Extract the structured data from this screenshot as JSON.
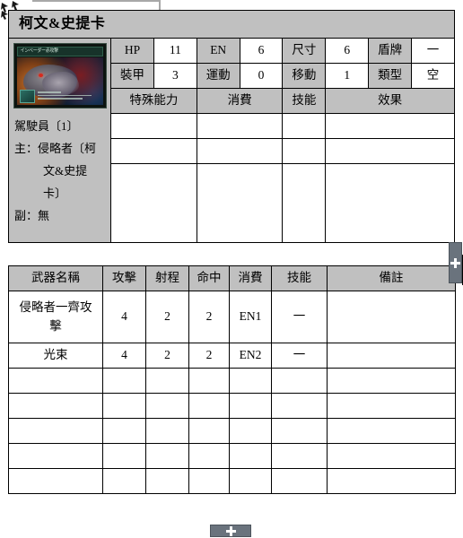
{
  "title": "柯文&史提卡",
  "portrait": {
    "art_banner_text": "インベーダー赤攻撃",
    "alt": "侵略者卡片插圖"
  },
  "pilot": {
    "heading": "駕駛員〔1〕",
    "main_line1": "主：侵略者〔柯",
    "main_line2": "文&史提",
    "main_line3": "卡〕",
    "sub": "副：無"
  },
  "stats": {
    "row1": [
      {
        "label": "HP",
        "value": "11"
      },
      {
        "label": "EN",
        "value": "6"
      },
      {
        "label": "尺寸",
        "value": "6"
      },
      {
        "label": "盾牌",
        "value": "一"
      }
    ],
    "row2": [
      {
        "label": "裝甲",
        "value": "3"
      },
      {
        "label": "運動",
        "value": "0"
      },
      {
        "label": "移動",
        "value": "1"
      },
      {
        "label": "類型",
        "value": "空"
      }
    ]
  },
  "ability_table": {
    "headers": [
      "特殊能力",
      "消費",
      "技能",
      "效果"
    ],
    "rows": [
      [
        "",
        "",
        "",
        ""
      ],
      [
        "",
        "",
        "",
        ""
      ],
      [
        "",
        "",
        "",
        ""
      ]
    ]
  },
  "weapon_table": {
    "headers": [
      "武器名稱",
      "攻擊",
      "射程",
      "命中",
      "消費",
      "技能",
      "備註"
    ],
    "rows": [
      {
        "name_line1": "侵略者一齊攻",
        "name_line2": "擊",
        "attack": "4",
        "range": "2",
        "hit": "2",
        "cost": "EN1",
        "skill": "一",
        "note": ""
      },
      {
        "name_line1": "光束",
        "name_line2": "",
        "attack": "4",
        "range": "2",
        "hit": "2",
        "cost": "EN2",
        "skill": "一",
        "note": ""
      },
      {
        "name_line1": "",
        "name_line2": "",
        "attack": "",
        "range": "",
        "hit": "",
        "cost": "",
        "skill": "",
        "note": ""
      },
      {
        "name_line1": "",
        "name_line2": "",
        "attack": "",
        "range": "",
        "hit": "",
        "cost": "",
        "skill": "",
        "note": ""
      },
      {
        "name_line1": "",
        "name_line2": "",
        "attack": "",
        "range": "",
        "hit": "",
        "cost": "",
        "skill": "",
        "note": ""
      },
      {
        "name_line1": "",
        "name_line2": "",
        "attack": "",
        "range": "",
        "hit": "",
        "cost": "",
        "skill": "",
        "note": ""
      },
      {
        "name_line1": "",
        "name_line2": "",
        "attack": "",
        "range": "",
        "hit": "",
        "cost": "",
        "skill": "",
        "note": ""
      }
    ]
  },
  "controls": {
    "add_row_handle": "+",
    "add_column_handle": "+"
  },
  "colors": {
    "header_bg": "#c0c0c0",
    "cell_bg": "#ffffff",
    "border": "#000000",
    "handle_bg": "#6a737d"
  }
}
